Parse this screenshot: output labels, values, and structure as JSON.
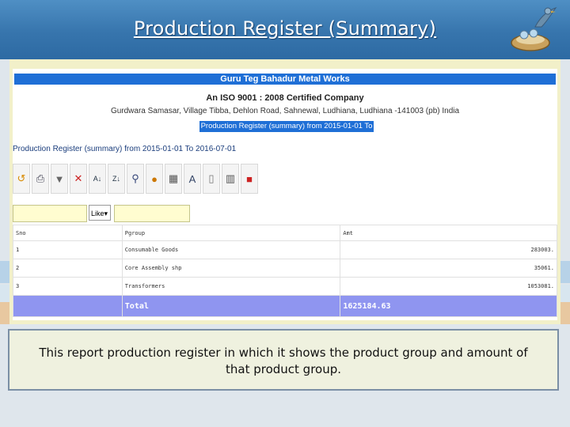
{
  "slide": {
    "title": "Production Register (Summary)"
  },
  "report": {
    "company_name": "Guru Teg Bahadur Metal Works",
    "certification": "An ISO 9001 : 2008 Certified Company",
    "address": "Gurdwara Samasar, Village Tibba, Dehlon Road, Sahnewal, Ludhiana, Ludhiana -141003 (pb) India",
    "title_box": "Production Register (summary) from 2015-01-01 To 2016-07-01",
    "caption": "Production Register (summary) from 2015-01-01 To 2016-07-01"
  },
  "toolbar": {
    "icons": [
      "refresh-icon",
      "print-icon",
      "filter-icon",
      "clear-filter-icon",
      "sort-asc-icon",
      "sort-desc-icon",
      "search-icon",
      "clear-search-icon",
      "grid-icon",
      "text-icon",
      "export-icon",
      "columns-icon",
      "pdf-icon"
    ]
  },
  "filter": {
    "operator": "Like"
  },
  "table": {
    "headers": [
      "Sno",
      "Pgroup",
      "Amt"
    ],
    "rows": [
      {
        "sno": "1",
        "group": "Consumable Goods",
        "amount": "283003."
      },
      {
        "sno": "2",
        "group": "Core Assembly shp",
        "amount": "35061."
      },
      {
        "sno": "3",
        "group": "Transformers",
        "amount": "1053081."
      }
    ],
    "total_label": "Total",
    "total_amount": "1625184.63"
  },
  "note": {
    "text": "This report production register in which it shows the product group and amount of that product group."
  },
  "colors": {
    "header_blue": "#3775ad",
    "company_bar": "#1f6fd6",
    "total_row": "#8f95f0",
    "filter_input": "#fffdd0"
  }
}
